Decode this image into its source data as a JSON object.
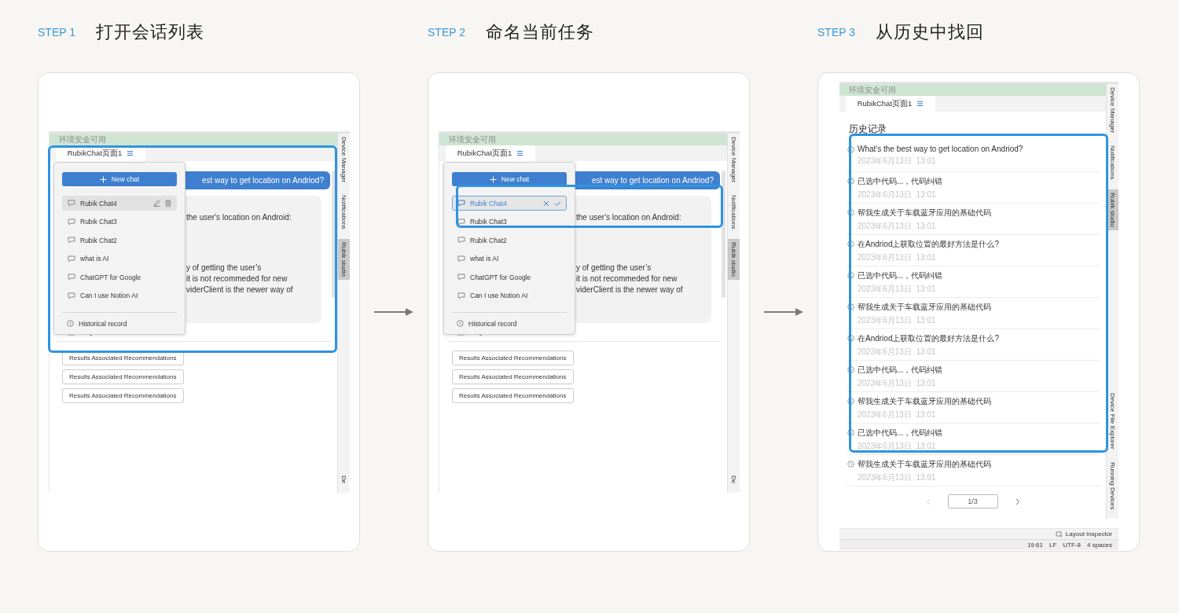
{
  "steps": [
    {
      "label": "STEP 1",
      "title": "打开会话列表",
      "screen": {
        "kind": "chat",
        "env_status": "环境安全可用",
        "tab": "RubikChat页面1",
        "question": "est way to get location on Andriod?",
        "answer_blocks": [
          [
            "the user's location on Android:"
          ],
          [
            "y of getting the user’s",
            "it is not recommeded for new",
            "viderClient is the newer way of"
          ]
        ],
        "recommendations": [
          "Results Associated Recommendations",
          "Results Associated Recommendations",
          "Results Associated Recommendations"
        ],
        "side_tabs_top": [
          {
            "label": "Device Manager",
            "selected": false
          },
          {
            "label": "Notifications",
            "selected": false
          },
          {
            "label": "Rubik studio",
            "selected": true
          }
        ],
        "side_tabs_bottom": [
          {
            "label": "De",
            "selected": false
          }
        ],
        "menu": {
          "new_chat": "New chat",
          "chats": [
            {
              "title": "Rubik Chat4",
              "selected": true,
              "editing": false
            },
            {
              "title": "Rubik Chat3",
              "selected": false,
              "editing": false
            },
            {
              "title": "Rubik Chat2",
              "selected": false,
              "editing": false
            },
            {
              "title": "what is AI",
              "selected": false,
              "editing": false
            },
            {
              "title": "ChatGPT for Google",
              "selected": false,
              "editing": false
            },
            {
              "title": "Can I use Notion AI",
              "selected": false,
              "editing": false
            }
          ],
          "history_link": "Historical record"
        }
      }
    },
    {
      "label": "STEP 2",
      "title": "命名当前任务",
      "screen": {
        "kind": "chat",
        "env_status": "环境安全可用",
        "tab": "RubikChat页面1",
        "question": "est way to get location on Andriod?",
        "answer_blocks": [
          [
            "the user's location on Android:"
          ],
          [
            "y of getting the user’s",
            "it is not recommeded for new",
            "viderClient is the newer way of"
          ]
        ],
        "recommendations": [
          "Results Associated Recommendations",
          "Results Associated Recommendations",
          "Results Associated Recommendations"
        ],
        "side_tabs_top": [
          {
            "label": "Device Manager",
            "selected": false
          },
          {
            "label": "Notifications",
            "selected": false
          },
          {
            "label": "Rubik studio",
            "selected": true
          }
        ],
        "side_tabs_bottom": [
          {
            "label": "De",
            "selected": false
          }
        ],
        "menu": {
          "new_chat": "New chat",
          "chats": [
            {
              "title": "Rubik Chat4",
              "selected": true,
              "editing": true
            },
            {
              "title": "Rubik Chat3",
              "selected": false,
              "editing": false
            },
            {
              "title": "Rubik Chat2",
              "selected": false,
              "editing": false
            },
            {
              "title": "what is AI",
              "selected": false,
              "editing": false
            },
            {
              "title": "ChatGPT for Google",
              "selected": false,
              "editing": false
            },
            {
              "title": "Can I use Notion AI",
              "selected": false,
              "editing": false
            }
          ],
          "history_link": "Historical record"
        }
      }
    },
    {
      "label": "STEP 3",
      "title": "从历史中找回",
      "screen": {
        "kind": "history",
        "env_status": "环境安全可用",
        "tab": "RubikChat页面1",
        "heading": "历史记录",
        "side_tabs_top": [
          {
            "label": "Device Manager",
            "selected": false
          },
          {
            "label": "Notifications",
            "selected": false
          },
          {
            "label": "Rubik studio",
            "selected": true
          }
        ],
        "side_tabs_bottom": [
          {
            "label": "Device File Explorer",
            "selected": false
          },
          {
            "label": "Running Devices",
            "selected": false
          }
        ],
        "history": [
          {
            "title": "What's the best way to get location on Andriod?",
            "time": "2023年6月13日  13:01"
          },
          {
            "title": "已选中代码...，代码纠错",
            "time": "2023年6月13日  13:01"
          },
          {
            "title": "帮我生成关于车载蓝牙应用的基础代码",
            "time": "2023年6月13日  13:01"
          },
          {
            "title": "在Andriod上获取位置的最好方法是什么?",
            "time": "2023年6月13日  13:01"
          },
          {
            "title": "已选中代码...，代码纠错",
            "time": "2023年6月13日  13:01"
          },
          {
            "title": "帮我生成关于车载蓝牙应用的基础代码",
            "time": "2023年6月13日  13:01"
          },
          {
            "title": "在Andriod上获取位置的最好方法是什么?",
            "time": "2023年6月13日  13:01"
          },
          {
            "title": "已选中代码...，代码纠错",
            "time": "2023年6月13日  13:01"
          },
          {
            "title": "帮我生成关于车载蓝牙应用的基础代码",
            "time": "2023年6月13日  13:01"
          },
          {
            "title": "已选中代码...，代码纠错",
            "time": "2023年6月13日  13:01"
          },
          {
            "title": "帮我生成关于车载蓝牙应用的基础代码",
            "time": "2023年6月13日  13:01"
          }
        ],
        "pager": {
          "text": "1/3",
          "prev_disabled": true
        },
        "tool_status": "Layout Inspector",
        "status_items": [
          "19:61",
          "LF",
          "UTF-8",
          "4 spaces"
        ]
      }
    }
  ]
}
